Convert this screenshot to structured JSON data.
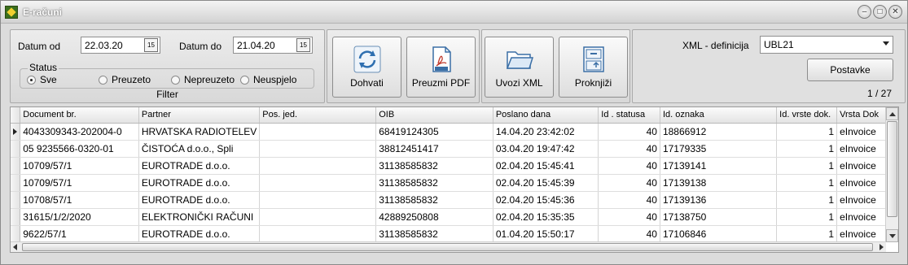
{
  "window": {
    "title": "E-računi"
  },
  "filter": {
    "date_from_label": "Datum od",
    "date_from_value": "22.03.20",
    "date_to_label": "Datum do",
    "date_to_value": "21.04.20",
    "status_label": "Status",
    "status_options": [
      "Sve",
      "Preuzeto",
      "Nepreuzeto",
      "Neuspjelo"
    ],
    "status_selected": "Sve",
    "caption": "Filter"
  },
  "actions": {
    "fetch_label": "Dohvati",
    "download_pdf_label": "Preuzmi PDF",
    "import_xml_label": "Uvozi XML",
    "post_label": "Proknjiži"
  },
  "xml": {
    "definition_label": "XML - definicija",
    "definition_value": "UBL21",
    "settings_label": "Postavke",
    "page_info": "1 / 27"
  },
  "grid": {
    "columns": [
      "Document br.",
      "Partner",
      "Pos. jed.",
      "OIB",
      "Poslano dana",
      "Id . statusa",
      "Id. oznaka",
      "Id. vrste dok.",
      "Vrsta Dok"
    ],
    "rows": [
      [
        "4043309343-202004-0",
        "HRVATSKA RADIOTELEV",
        "",
        "68419124305",
        "14.04.20 23:42:02",
        "40",
        "18866912",
        "1",
        "eInvoice"
      ],
      [
        "05 9235566-0320-01",
        "ČISTOĆA d.o.o., Spli",
        "",
        "38812451417",
        "03.04.20 19:47:42",
        "40",
        "17179335",
        "1",
        "eInvoice"
      ],
      [
        "10709/57/1",
        "EUROTRADE d.o.o.",
        "",
        "31138585832",
        "02.04.20 15:45:41",
        "40",
        "17139141",
        "1",
        "eInvoice"
      ],
      [
        "10709/57/1",
        "EUROTRADE d.o.o.",
        "",
        "31138585832",
        "02.04.20 15:45:39",
        "40",
        "17139138",
        "1",
        "eInvoice"
      ],
      [
        "10708/57/1",
        "EUROTRADE d.o.o.",
        "",
        "31138585832",
        "02.04.20 15:45:36",
        "40",
        "17139136",
        "1",
        "eInvoice"
      ],
      [
        "31615/1/2/2020",
        "ELEKTRONIČKI RAČUNI",
        "",
        "42889250808",
        "02.04.20 15:35:35",
        "40",
        "17138750",
        "1",
        "eInvoice"
      ],
      [
        "9622/57/1",
        "EUROTRADE d.o.o.",
        "",
        "31138585832",
        "01.04.20 15:50:17",
        "40",
        "17106846",
        "1",
        "eInvoice"
      ]
    ]
  },
  "colors": {
    "window_bg": "#dcdcdc",
    "grid_bg": "#ffffff",
    "border": "#8a8a8a"
  }
}
